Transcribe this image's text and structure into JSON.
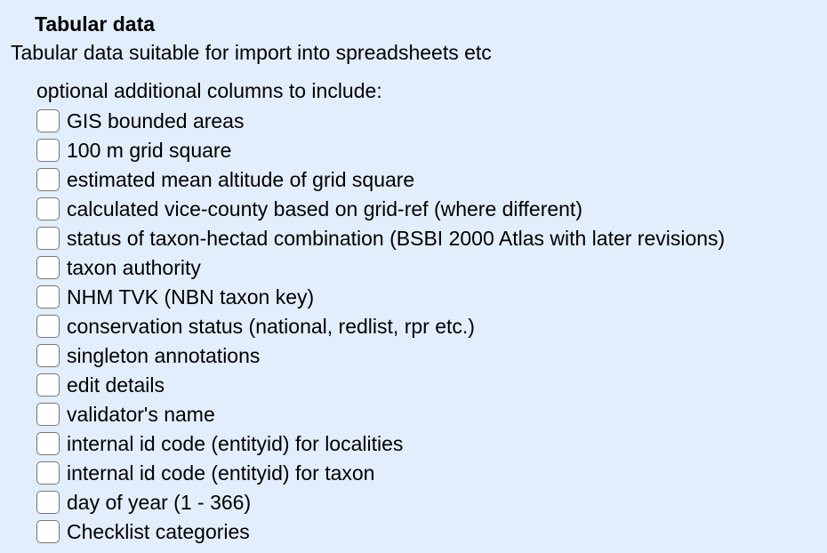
{
  "section": {
    "title": "Tabular data",
    "description": "Tabular data suitable for import into spreadsheets etc",
    "options_label": "optional additional columns to include:"
  },
  "options": [
    {
      "label": "GIS bounded areas",
      "checked": false
    },
    {
      "label": "100 m grid square",
      "checked": false
    },
    {
      "label": "estimated mean altitude of grid square",
      "checked": false
    },
    {
      "label": "calculated vice-county based on grid-ref (where different)",
      "checked": false
    },
    {
      "label": "status of taxon-hectad combination (BSBI 2000 Atlas with later revisions)",
      "checked": false
    },
    {
      "label": "taxon authority",
      "checked": false
    },
    {
      "label": "NHM TVK (NBN taxon key)",
      "checked": false
    },
    {
      "label": "conservation status (national, redlist, rpr etc.)",
      "checked": false
    },
    {
      "label": "singleton annotations",
      "checked": false
    },
    {
      "label": "edit details",
      "checked": false
    },
    {
      "label": "validator's name",
      "checked": false
    },
    {
      "label": "internal id code (entityid) for localities",
      "checked": false
    },
    {
      "label": "internal id code (entityid) for taxon",
      "checked": false
    },
    {
      "label": "day of year (1 - 366)",
      "checked": false
    },
    {
      "label": "Checklist categories",
      "checked": false
    }
  ],
  "colors": {
    "background": "#e3eefc",
    "checkbox_border": "#767676",
    "checkbox_fill": "#ffffff"
  }
}
